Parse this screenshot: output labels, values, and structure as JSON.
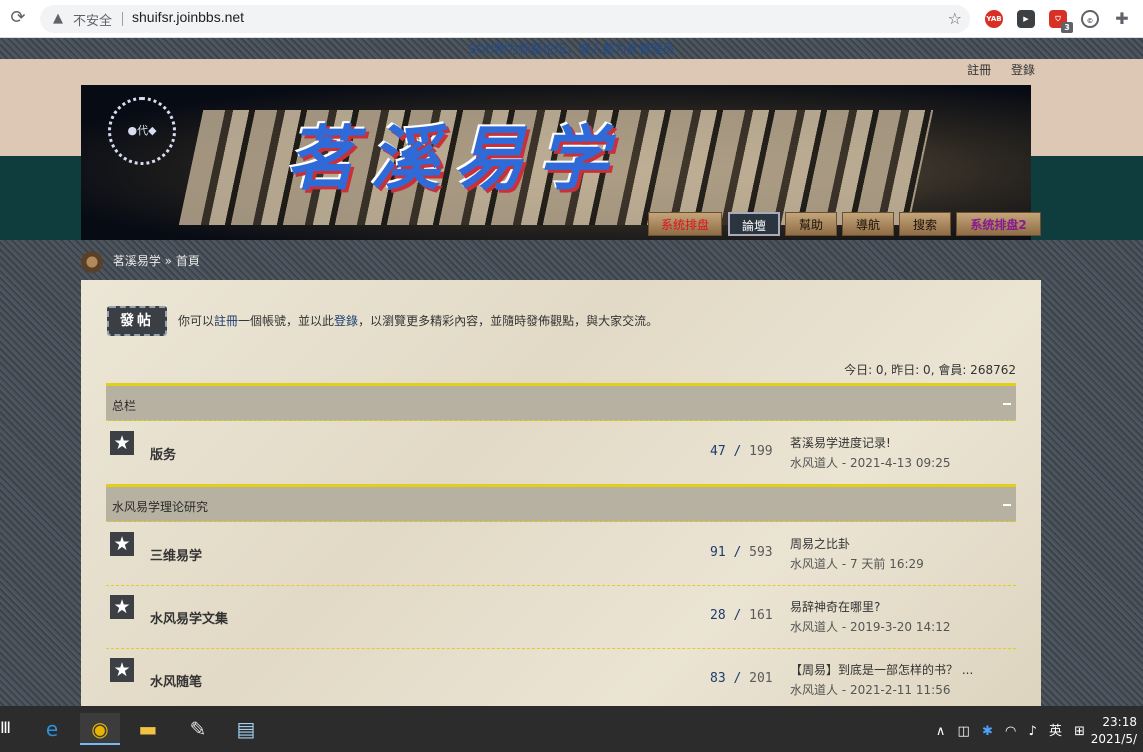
{
  "browser": {
    "security_label": "不安全",
    "url": "shuifsr.joinbbs.net",
    "extensions": [
      {
        "name": "yab-extension-icon",
        "label": "YAB"
      },
      {
        "name": "video-extension-icon",
        "label": "▶"
      },
      {
        "name": "shield-extension-icon",
        "label": "⛉",
        "badge": "3"
      },
      {
        "name": "circle-extension-icon",
        "label": "©"
      },
      {
        "name": "puzzle-extension-icon",
        "label": "✚"
      }
    ]
  },
  "site": {
    "marquee": "SOH物为标题论坛，城人都为其管理员",
    "top_links": {
      "register": "註冊",
      "login": "登錄"
    },
    "banner": {
      "seal": "●代◆",
      "title": "茗溪易学"
    },
    "nav": [
      {
        "label": "系统排盘",
        "style": "red"
      },
      {
        "label": "論壇",
        "style": "active"
      },
      {
        "label": "幫助",
        "style": "normal"
      },
      {
        "label": "導航",
        "style": "normal"
      },
      {
        "label": "搜索",
        "style": "normal"
      },
      {
        "label": "系统排盘2",
        "style": "purple"
      }
    ],
    "breadcrumb": {
      "root": "茗溪易学",
      "sep": "»",
      "current": "首頁"
    }
  },
  "main": {
    "post_button": "發帖",
    "notice": {
      "prefix": "你可以",
      "register_link": "註冊",
      "mid1": "一個帳號，並以此",
      "login_link": "登錄",
      "suffix": "，以瀏覽更多精彩內容，並隨時發佈觀點，與大家交流。"
    },
    "stats": "今日: 0, 昨日: 0, 會員: 268762",
    "categories": [
      {
        "title": "总栏",
        "forums": [
          {
            "name": "版务",
            "threads": "47",
            "posts": "199",
            "last_title": "茗溪易学进度记录!",
            "last_meta": "水风道人 - 2021-4-13 09:25"
          }
        ]
      },
      {
        "title": "水风易学理论研究",
        "forums": [
          {
            "name": "三维易学",
            "threads": "91",
            "posts": "593",
            "last_title": "周易之比卦",
            "last_meta": "水风道人 - 7 天前 16:29"
          },
          {
            "name": "水风易学文集",
            "threads": "28",
            "posts": "161",
            "last_title": "易辞神奇在哪里?",
            "last_meta": "水风道人 - 2019-3-20 14:12"
          },
          {
            "name": "水风随笔",
            "threads": "83",
            "posts": "201",
            "last_title": "【周易】到底是一部怎样的书？ ...",
            "last_meta": "水风道人 - 2021-2-11 11:56"
          }
        ]
      }
    ]
  },
  "taskbar": {
    "left_glyph": "Ⅲ",
    "apps": [
      {
        "name": "edge-icon",
        "glyph": "e",
        "color": "#2f8fd8"
      },
      {
        "name": "chrome-icon",
        "glyph": "◉",
        "color": "#e8b400"
      },
      {
        "name": "file-explorer-icon",
        "glyph": "▬",
        "color": "#f2c245"
      },
      {
        "name": "paint-icon",
        "glyph": "✎",
        "color": "#e0e0e0"
      },
      {
        "name": "notepad-icon",
        "glyph": "▤",
        "color": "#9fd0f0"
      }
    ],
    "tray": {
      "chevron": "∧",
      "ime": "英",
      "grid": "⊞"
    },
    "clock": {
      "time": "23:18",
      "date": "2021/5/"
    }
  }
}
